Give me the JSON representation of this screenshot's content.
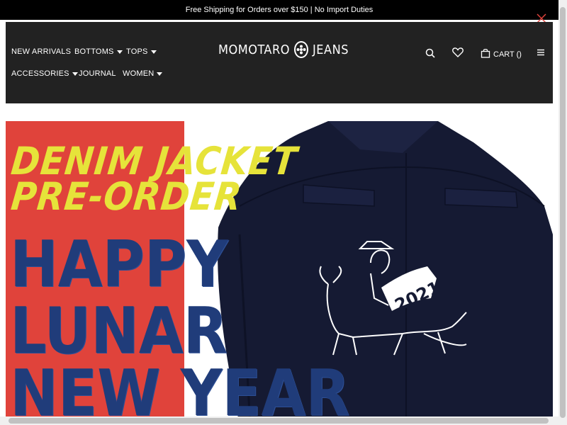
{
  "announcement": {
    "text": "Free Shipping for Orders over $150 | No Import Duties"
  },
  "nav": {
    "items": [
      {
        "label": "NEW ARRIVALS",
        "has_dropdown": false
      },
      {
        "label": "BOTTOMS",
        "has_dropdown": true
      },
      {
        "label": "TOPS",
        "has_dropdown": true
      },
      {
        "label": "ACCESSORIES",
        "has_dropdown": true
      },
      {
        "label": "JOURNAL",
        "has_dropdown": false
      },
      {
        "label": "WOMEN",
        "has_dropdown": true
      }
    ]
  },
  "logo": {
    "left_text": "MOMOTARO",
    "right_text": "JEANS"
  },
  "header_actions": {
    "cart_label": "CART ()",
    "icons": [
      "search-icon",
      "heart-icon",
      "cart-icon",
      "menu-icon"
    ]
  },
  "hero": {
    "line1": "DENIM JACKET",
    "line2": "PRE-ORDER",
    "line3": "HAPPY",
    "line4": "LUNAR",
    "line5": "NEW YEAR",
    "badge_year": "2021"
  },
  "colors": {
    "header_bg": "#222222",
    "announcement_bg": "#000000",
    "hero_red": "#e0433b",
    "headline_yellow": "#e6e33a",
    "denim_blue": "#203c7a",
    "jacket_navy": "#151a33",
    "close_icon": "#e0433b"
  }
}
